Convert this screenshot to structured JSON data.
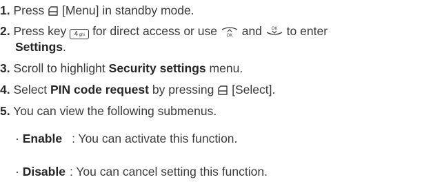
{
  "steps": {
    "s1": {
      "num": "1.",
      "pre": "Press",
      "menu": "[Menu] in standby mode."
    },
    "s2": {
      "num": "2.",
      "pre": "Press key",
      "key": "4",
      "mid": "for direct access or use",
      "and": "and",
      "post": "to enter",
      "bold": "Settings",
      "end": "."
    },
    "s3": {
      "num": "3.",
      "pre": "Scroll to highlight",
      "bold": "Security settings",
      "post": "menu."
    },
    "s4": {
      "num": "4.",
      "pre": "Select",
      "bold": "PIN code request",
      "post": "by pressing",
      "select": "[Select]."
    },
    "s5": {
      "num": "5.",
      "text": "You can view the following submenus."
    }
  },
  "submenus": [
    {
      "bullet": "·",
      "name": "Enable",
      "desc": ": You can activate this function."
    },
    {
      "bullet": "·",
      "name": "Disable",
      "desc": ": You can cancel setting this function."
    }
  ],
  "icons": [
    "soft-key-icon",
    "keypad-4-icon",
    "nav-up-icon",
    "nav-down-icon"
  ]
}
